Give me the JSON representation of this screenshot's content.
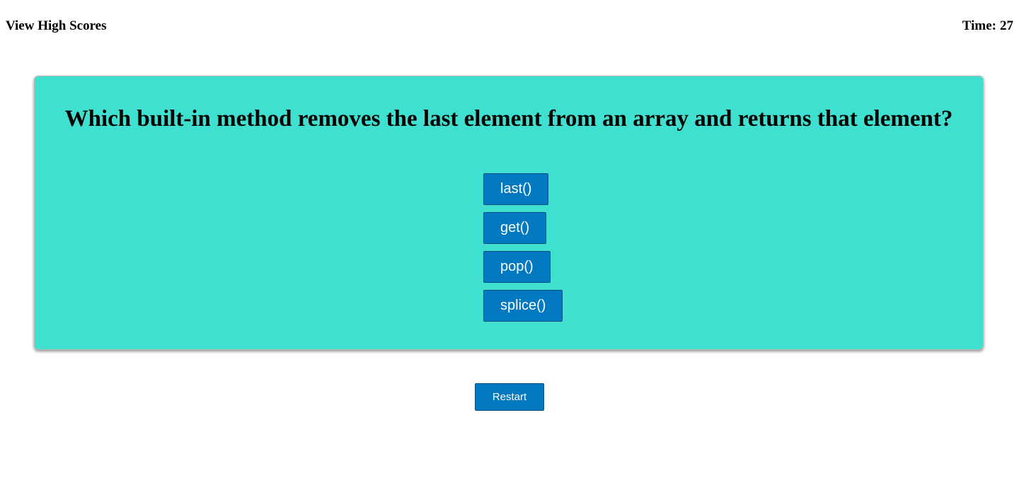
{
  "header": {
    "view_high_scores": "View High Scores",
    "time_label": "Time:",
    "time_value": "27"
  },
  "quiz": {
    "question": "Which built-in method removes the last element from an array and returns that element?",
    "choices": [
      {
        "label": "last()"
      },
      {
        "label": "get()"
      },
      {
        "label": "pop()"
      },
      {
        "label": "splice()"
      }
    ]
  },
  "controls": {
    "restart_label": "Restart"
  },
  "colors": {
    "card_background": "#40e0d0",
    "button_background": "#0079c1",
    "button_text": "#ffffff"
  }
}
